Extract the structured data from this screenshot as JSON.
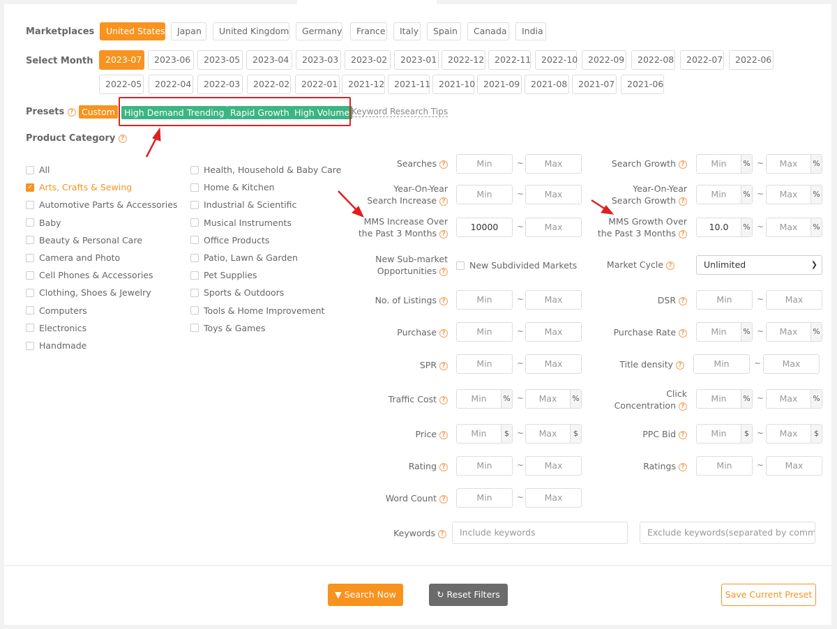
{
  "marketplaces": {
    "label": "Marketplaces",
    "items": [
      "United States",
      "Japan",
      "United Kingdom",
      "Germany",
      "France",
      "Italy",
      "Spain",
      "Canada",
      "India"
    ],
    "selected": "United States"
  },
  "month": {
    "label": "Select Month",
    "items": [
      "2023-07",
      "2023-06",
      "2023-05",
      "2023-04",
      "2023-03",
      "2023-02",
      "2023-01",
      "2022-12",
      "2022-11",
      "2022-10",
      "2022-09",
      "2022-08",
      "2022-07",
      "2022-06",
      "2022-05",
      "2022-04",
      "2022-03",
      "2022-02",
      "2022-01",
      "2021-12",
      "2021-11",
      "2021-10",
      "2021-09",
      "2021-08",
      "2021-07",
      "2021-06"
    ],
    "selected": "2023-07"
  },
  "presets": {
    "label": "Presets",
    "custom": "Custom",
    "items": [
      "High Demand",
      "Trending",
      "Rapid Growth",
      "High Volume"
    ],
    "tips": "Keyword Research Tips"
  },
  "category": {
    "label": "Product Category",
    "col1": [
      "All",
      "Arts, Crafts & Sewing",
      "Automotive Parts & Accessories",
      "Baby",
      "Beauty & Personal Care",
      "Camera and Photo",
      "Cell Phones & Accessories",
      "Clothing, Shoes & Jewelry",
      "Computers",
      "Electronics",
      "Handmade"
    ],
    "col2": [
      "Health, Household & Baby Care",
      "Home & Kitchen",
      "Industrial & Scientific",
      "Musical Instruments",
      "Office Products",
      "Patio, Lawn & Garden",
      "Pet Supplies",
      "Sports & Outdoors",
      "Tools & Home Improvement",
      "Toys & Games"
    ],
    "checked": "Arts, Crafts & Sewing"
  },
  "filters": {
    "min": "Min",
    "max": "Max",
    "tilde": "~",
    "percent": "%",
    "dollar": "$",
    "searches": "Searches",
    "search_growth": "Search Growth",
    "yoy_increase": [
      "Year-On-Year",
      "Search Increase"
    ],
    "yoy_growth": [
      "Year-On-Year",
      "Search Growth"
    ],
    "mms_increase": [
      "MMS Increase Over",
      "the Past 3 Months"
    ],
    "mms_increase_min": "10000",
    "mms_growth": [
      "MMS Growth Over",
      "the Past 3 Months"
    ],
    "mms_growth_min": "10.0",
    "new_submarket": [
      "New Sub-market",
      "Opportunities"
    ],
    "new_subdivided": "New Subdivided Markets",
    "market_cycle": "Market Cycle",
    "market_cycle_value": "Unlimited",
    "listings": "No. of Listings",
    "dsr": "DSR",
    "purchase": "Purchase",
    "purchase_rate": "Purchase Rate",
    "spr": "SPR",
    "title_density": "Title density",
    "traffic_cost": "Traffic Cost",
    "click_concentration": [
      "Click",
      "Concentration"
    ],
    "price": "Price",
    "ppc_bid": "PPC Bid",
    "rating": "Rating",
    "ratings": "Ratings",
    "word_count": "Word Count",
    "keywords": "Keywords",
    "include_placeholder": "Include keywords",
    "exclude_placeholder": "Exclude keywords(separated by commas)"
  },
  "actions": {
    "search": "Search Now",
    "reset": "Reset Filters",
    "save": "Save Current Preset"
  },
  "colors": {
    "accent": "#f7931e",
    "preset_green": "#3cb582",
    "annotation_red": "#e02020"
  }
}
